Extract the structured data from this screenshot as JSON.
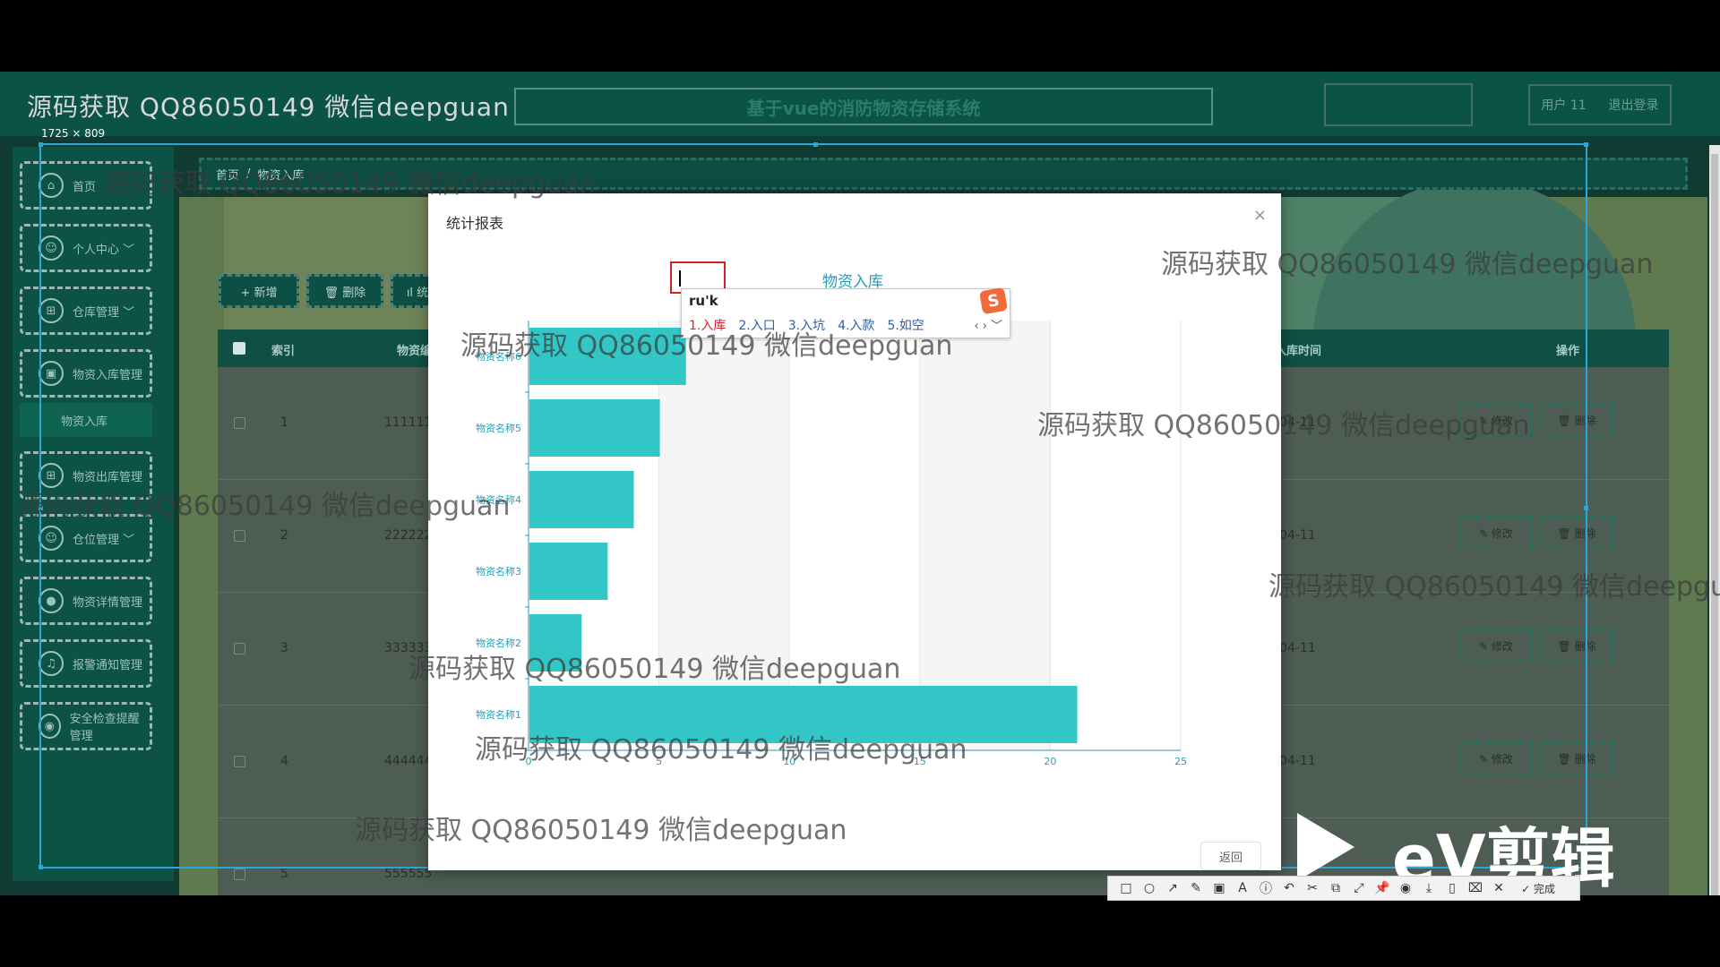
{
  "header": {
    "brand": "源码获取 QQ86050149 微信deepguan",
    "system_title": "基于vue的消防物资存储系统",
    "user_label": "用户 11",
    "logout_label": "退出登录"
  },
  "selection_size": "1725 × 809",
  "sidebar": {
    "items": [
      {
        "label": "首页",
        "icon": "home-icon"
      },
      {
        "label": "个人中心 ﹀",
        "icon": "user-icon"
      },
      {
        "label": "仓库管理 ﹀",
        "icon": "grid-icon"
      },
      {
        "label": "物资入库管理",
        "icon": "box-icon"
      },
      {
        "label": "物资出库管理",
        "icon": "grid-icon"
      },
      {
        "label": "仓位管理 ﹀",
        "icon": "user-icon"
      },
      {
        "label": "物资详情管理",
        "icon": "info-icon"
      },
      {
        "label": "报警通知管理",
        "icon": "bell-icon"
      },
      {
        "label": "安全检查提醒管理",
        "icon": "shield-icon"
      }
    ],
    "sub_item": "物资入库"
  },
  "breadcrumb": {
    "home": "首页",
    "sep": "/",
    "current": "物资入库"
  },
  "toolbar": {
    "add": "+ 新增",
    "delete": "🗑 删除",
    "stats": "ıl 统"
  },
  "table": {
    "headers": {
      "index": "索引",
      "name": "物资编",
      "time": "入库时间",
      "ops": "操作"
    },
    "rows": [
      {
        "index": "1",
        "name": "111111",
        "date": "-04-11"
      },
      {
        "index": "2",
        "name": "222222",
        "date": "-04-11"
      },
      {
        "index": "3",
        "name": "333333",
        "date": "-04-11"
      },
      {
        "index": "4",
        "name": "444444",
        "date": "-04-11"
      },
      {
        "index": "5",
        "name": "555555",
        "date": ""
      }
    ],
    "edit_label": "✎ 修改",
    "delete_label": "🗑 删除"
  },
  "modal": {
    "title": "统计报表",
    "close": "×",
    "back": "返回"
  },
  "chart_data": {
    "type": "bar",
    "orientation": "horizontal",
    "title": "物资入库",
    "categories": [
      "物资名称1",
      "物资名称2",
      "物资名称3",
      "物资名称4",
      "物资名称5",
      "物资名称6"
    ],
    "values": [
      21,
      2,
      3,
      4,
      5,
      6
    ],
    "xlim": [
      0,
      25
    ],
    "xticks": [
      0,
      5,
      10,
      15,
      20,
      25
    ],
    "grid": true,
    "bar_color": "#33c6c6"
  },
  "ime": {
    "input": "ru'k",
    "candidates": [
      "1.入库",
      "2.入口",
      "3.入坑",
      "4.入款",
      "5.如空"
    ],
    "nav": "‹ › ﹀"
  },
  "watermark_text": "源码获取 QQ86050149 微信deepguan",
  "watermark_text_cut": "源码获取 QQ86050149 微信deepgu",
  "ev_logo": "eV剪辑",
  "screenshot_toolbar": {
    "tools": [
      "□",
      "○",
      "↗",
      "✎",
      "▣",
      "A",
      "ⓘ",
      "↶",
      "✂",
      "⧉",
      "⤢",
      "📌",
      "◉",
      "⤓",
      "▯",
      "⌧",
      "✕"
    ],
    "done": "✓ 完成"
  }
}
